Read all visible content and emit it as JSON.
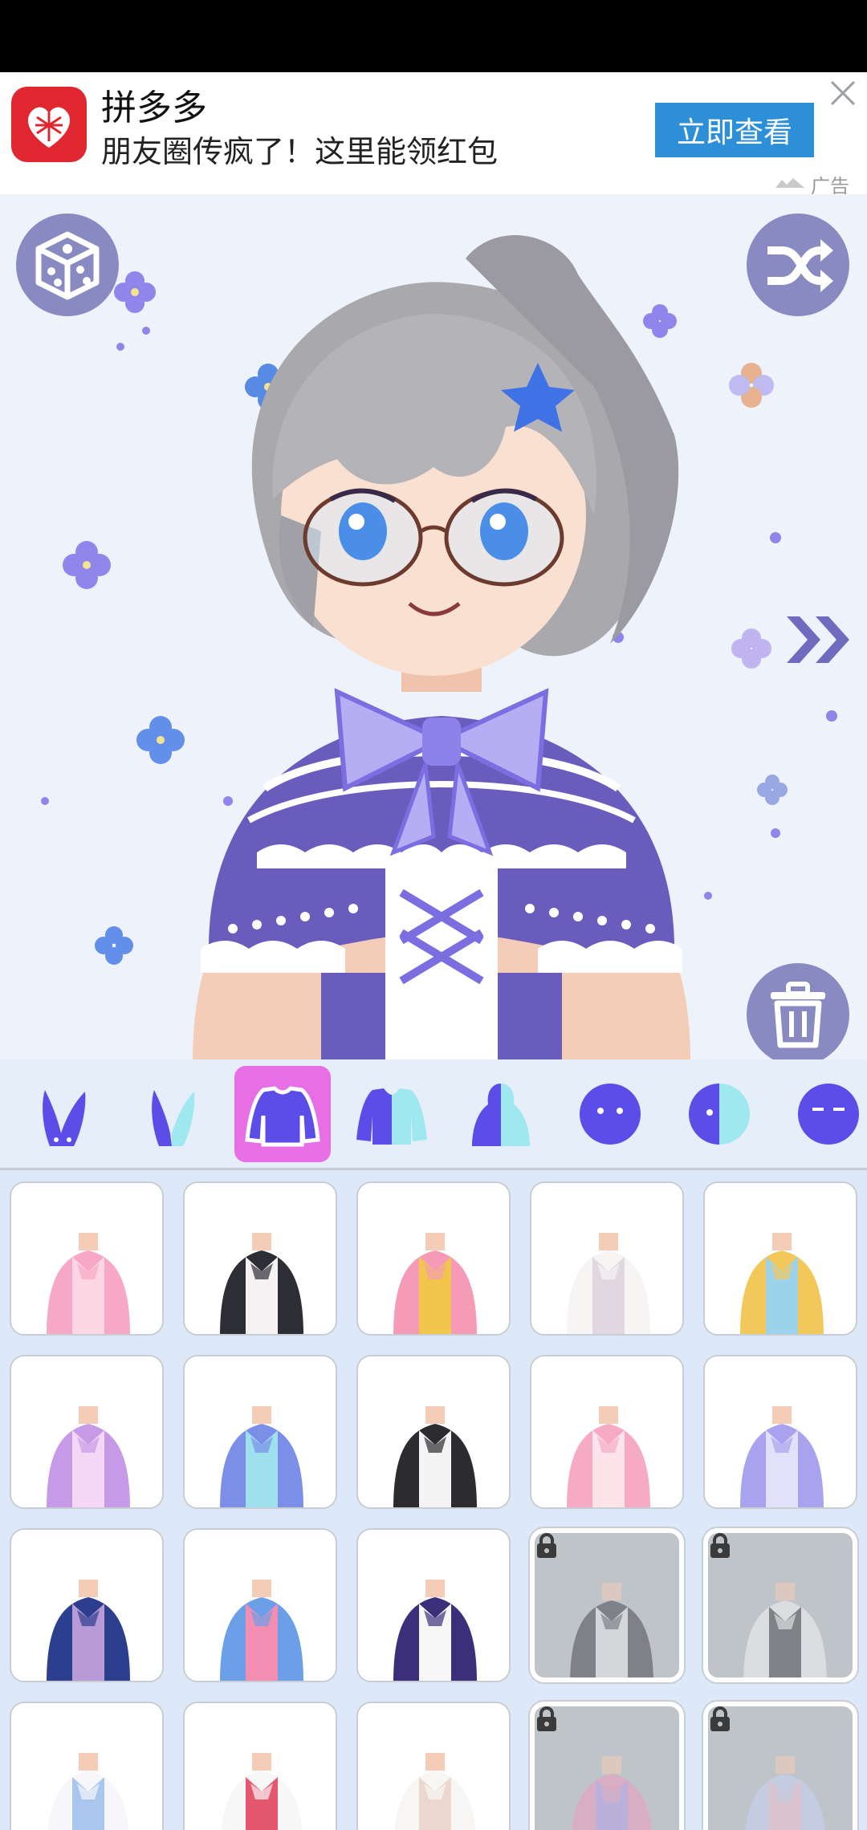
{
  "ad": {
    "app_name": "拼多多",
    "subtitle": "朋友圈传疯了！这里能领红包",
    "cta_label": "立即查看",
    "ad_label": "广告",
    "logo_color": "#e0262e",
    "cta_color": "#2e8fd9"
  },
  "stage": {
    "background_color": "#eef3fb",
    "buttons": [
      "dice-icon",
      "shuffle-icon",
      "trash-icon",
      "double-chevron-right-icon"
    ],
    "button_color": "#8a8ac2"
  },
  "categories": {
    "items": [
      {
        "id": "ears",
        "icon": "bunny-ears-icon"
      },
      {
        "id": "ears-color",
        "icon": "bunny-ears-two-tone-icon"
      },
      {
        "id": "tops",
        "icon": "sweater-icon",
        "active": true
      },
      {
        "id": "tops-color",
        "icon": "sweater-two-tone-icon"
      },
      {
        "id": "body",
        "icon": "torso-two-tone-icon"
      },
      {
        "id": "face",
        "icon": "face-circle-icon"
      },
      {
        "id": "face-color",
        "icon": "face-two-tone-icon"
      },
      {
        "id": "eyes",
        "icon": "closed-eyes-icon"
      }
    ],
    "active_color": "#e86ee6",
    "icon_color": "#5b4ee8",
    "icon_accent": "#9fe8f0"
  },
  "outfits": {
    "rows": [
      [
        {
          "name": "pink-striped-shirt",
          "locked": false
        },
        {
          "name": "jacket-pink-bow",
          "locked": false
        },
        {
          "name": "pink-dress-gold-bow",
          "locked": false
        },
        {
          "name": "white-frill-blouse",
          "locked": false
        },
        {
          "name": "gold-bikini-top",
          "locked": false
        }
      ],
      [
        {
          "name": "purple-offshoulder-dress",
          "locked": false
        },
        {
          "name": "blue-lolita-dress",
          "locked": false
        },
        {
          "name": "black-suspender-outfit",
          "locked": false
        },
        {
          "name": "pink-frill-top",
          "locked": false
        },
        {
          "name": "lavender-camisole",
          "locked": false
        }
      ],
      [
        {
          "name": "navy-blazer",
          "locked": false
        },
        {
          "name": "blue-crop-top",
          "locked": false
        },
        {
          "name": "white-crop-purple-jacket",
          "locked": false
        },
        {
          "name": "grey-offshoulder-top",
          "locked": true
        },
        {
          "name": "white-ruffle-crop",
          "locked": true
        }
      ],
      [
        {
          "name": "white-lace-blouse",
          "locked": false
        },
        {
          "name": "sailor-uniform",
          "locked": false
        },
        {
          "name": "white-button-shirt",
          "locked": false
        },
        {
          "name": "pink-magical-outfit",
          "locked": true
        },
        {
          "name": "lace-top",
          "locked": true
        }
      ]
    ]
  }
}
